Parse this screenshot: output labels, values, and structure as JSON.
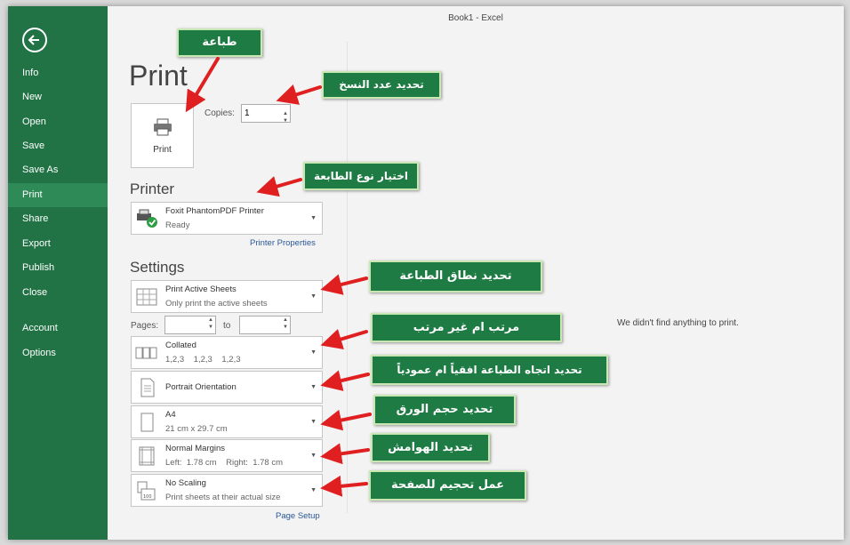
{
  "window": {
    "title": "Book1 - Excel"
  },
  "sidebar": {
    "items": [
      {
        "label": "Info"
      },
      {
        "label": "New"
      },
      {
        "label": "Open"
      },
      {
        "label": "Save"
      },
      {
        "label": "Save As"
      },
      {
        "label": "Print",
        "active": true
      },
      {
        "label": "Share"
      },
      {
        "label": "Export"
      },
      {
        "label": "Publish"
      },
      {
        "label": "Close"
      },
      {
        "label": "Account"
      },
      {
        "label": "Options"
      }
    ]
  },
  "print": {
    "title": "Print",
    "button_label": "Print",
    "copies_label": "Copies:",
    "copies_value": "1"
  },
  "printer": {
    "heading": "Printer",
    "name": "Foxit PhantomPDF Printer",
    "status": "Ready",
    "properties_link": "Printer Properties"
  },
  "settings": {
    "heading": "Settings",
    "scope": {
      "title": "Print Active Sheets",
      "subtitle": "Only print the active sheets"
    },
    "pages_label": "Pages:",
    "to_label": "to",
    "collation": {
      "title": "Collated",
      "subtitle": "1,2,3    1,2,3    1,2,3"
    },
    "orientation": {
      "title": "Portrait Orientation"
    },
    "paper": {
      "title": "A4",
      "subtitle": "21 cm x 29.7 cm"
    },
    "margins": {
      "title": "Normal Margins",
      "subtitle": "Left:  1.78 cm    Right:  1.78 cm"
    },
    "scaling": {
      "title": "No Scaling",
      "subtitle": "Print sheets at their actual size"
    },
    "page_setup_link": "Page Setup"
  },
  "preview": {
    "empty_message": "We didn't find anything to print."
  },
  "callouts": {
    "print": "طباعة",
    "copies": "تحديد عدد النسخ",
    "printer": "اختيار نوع الطابعة",
    "range": "تحديد نطاق الطباعة",
    "collate": "مرتب ام غير مرتب",
    "orientation": "تحديد اتجاه الطباعة افقياً ام عمودياً",
    "paper": "تحديد حجم الورق",
    "margins": "تحديد الهوامش",
    "scaling": "عمل تحجيم للصفحة"
  },
  "colors": {
    "sidebar": "#217346",
    "callout": "#1e7b44",
    "arrow": "#e02020",
    "link": "#2b579a"
  }
}
